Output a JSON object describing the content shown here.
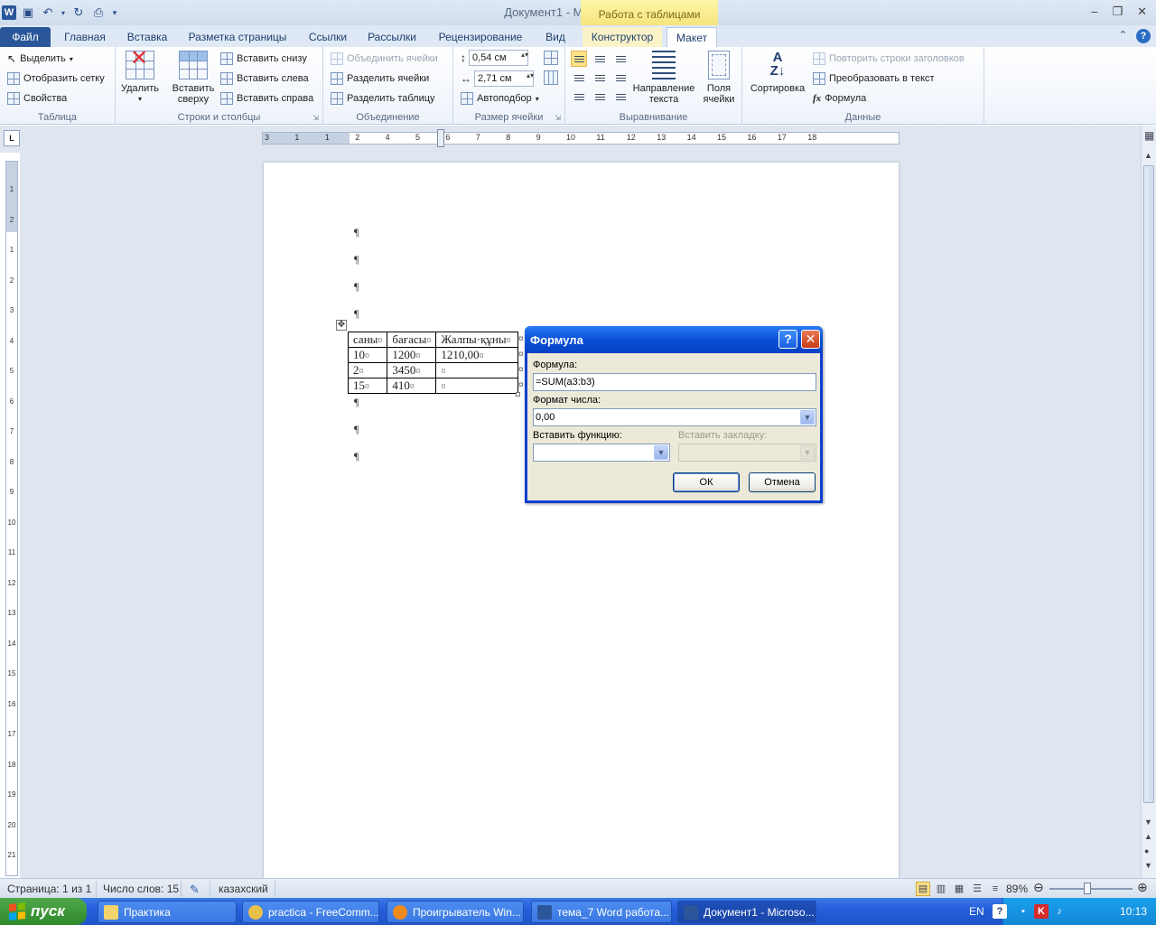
{
  "window": {
    "title": "Документ1  -  Microsoft Word",
    "contextual_tab_group": "Работа с таблицами"
  },
  "ribbon_tabs": [
    "Файл",
    "Главная",
    "Вставка",
    "Разметка страницы",
    "Ссылки",
    "Рассылки",
    "Рецензирование",
    "Вид",
    "Конструктор",
    "Макет"
  ],
  "active_tab": "Макет",
  "ribbon": {
    "table": {
      "label": "Таблица",
      "select": "Выделить",
      "show_grid": "Отобразить сетку",
      "properties": "Свойства"
    },
    "rows_cols": {
      "label": "Строки и столбцы",
      "delete": "Удалить",
      "insert_above_1": "Вставить",
      "insert_above_2": "сверху",
      "insert_below": "Вставить снизу",
      "insert_left": "Вставить слева",
      "insert_right": "Вставить справа"
    },
    "merge": {
      "label": "Объединение",
      "merge_cells": "Объединить ячейки",
      "split_cells": "Разделить ячейки",
      "split_table": "Разделить таблицу"
    },
    "cell_size": {
      "label": "Размер ячейки",
      "height": "0,54 см",
      "width": "2,71 см",
      "autofit": "Автоподбор"
    },
    "alignment": {
      "label": "Выравнивание",
      "text_direction_1": "Направление",
      "text_direction_2": "текста",
      "cell_margins_1": "Поля",
      "cell_margins_2": "ячейки"
    },
    "data": {
      "label": "Данные",
      "sort": "Сортировка",
      "repeat_header": "Повторить строки заголовков",
      "convert_text": "Преобразовать в текст",
      "formula": "Формула"
    }
  },
  "ruler": {
    "h_ticks": [
      "3",
      "1",
      "1",
      "2",
      "4",
      "5",
      "6",
      "7",
      "8",
      "9",
      "10",
      "11",
      "12",
      "13",
      "14",
      "15",
      "16",
      "17",
      "18"
    ],
    "v_ticks": [
      "1",
      "2",
      "1",
      "2",
      "3",
      "4",
      "5",
      "6",
      "7",
      "8",
      "9",
      "10",
      "11",
      "12",
      "13",
      "14",
      "15",
      "16",
      "17",
      "18",
      "19",
      "20",
      "21"
    ]
  },
  "document": {
    "pilcrow": "¶",
    "cell_mark": "¤",
    "table": [
      [
        "саны",
        "бағасы",
        "Жалпы·құны"
      ],
      [
        "10",
        "1200",
        "1210,00"
      ],
      [
        "2",
        "3450",
        ""
      ],
      [
        "15",
        "410",
        ""
      ]
    ]
  },
  "dialog": {
    "title": "Формула",
    "formula_label": "Формула:",
    "formula_value": "=SUM(a3:b3)",
    "number_format_label": "Формат числа:",
    "number_format_value": "0,00",
    "paste_function_label": "Вставить функцию:",
    "paste_bookmark_label": "Вставить закладку:",
    "ok": "ОК",
    "cancel": "Отмена",
    "help_glyph": "?",
    "close_glyph": "✕"
  },
  "statusbar": {
    "page": "Страница: 1 из 1",
    "words": "Число слов: 15",
    "language": "казахский",
    "zoom": "89%"
  },
  "taskbar": {
    "start": "пуск",
    "items": [
      "Практика",
      "practica - FreeComm...",
      "Проигрыватель Win...",
      "тема_7 Word работа...",
      "Документ1 - Microso..."
    ],
    "lang": "EN",
    "clock": "10:13"
  },
  "colors": {
    "file_tab": "#2b579a",
    "dialog_title": "#0a4fd8",
    "taskbar": "#245edb",
    "start_button": "#3a9636"
  }
}
